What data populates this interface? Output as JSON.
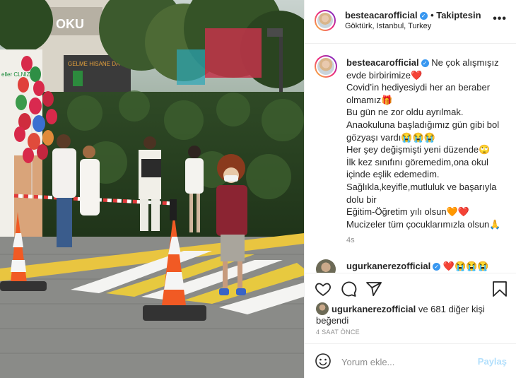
{
  "post": {
    "username": "besteacarofficial",
    "follow_label": "• Takiptesin",
    "location": "Göktürk, Istanbul, Turkey",
    "more_label": "•••"
  },
  "caption": {
    "username": "besteacarofficial",
    "text": "Ne çok alışmışız evde birbirimize❤️\nCovid’in hediyesiydi her an beraber olmamız🎁\nBu gün ne zor oldu ayrılmak.\nAnaokuluna başladığımız gün gibi bol gözyaşı vardı😭😭😭\nHer şey değişmişti yeni düzende🙄\nİlk kez sınıfını göremedim,ona okul içinde eşlik edemedim.\nSağlıkla,keyifle,mutluluk ve başarıyla dolu bir\nEğitim-Öğretim yılı olsun🧡❤️\nMucizeler tüm çocuklarımızla olsun🙏",
    "time": "4s"
  },
  "comment": {
    "username": "ugurkanerezofficial",
    "text": "❤️😭😭😭"
  },
  "likes": {
    "username": "ugurkanerezofficial",
    "rest": " ve 681 diğer kişi beğendi"
  },
  "age": "4 SAAT ÖNCE",
  "add_comment": {
    "placeholder": "Yorum ekle...",
    "post_label": "Paylaş"
  },
  "photo": {
    "sign_top": "AR OKU",
    "sign_mid": "GELME HISANE DA",
    "sign_left": "eller\nCLNIZ",
    "icons": [
      "heart-icon",
      "comment-icon",
      "share-icon",
      "bookmark-icon",
      "emoji-icon"
    ]
  }
}
